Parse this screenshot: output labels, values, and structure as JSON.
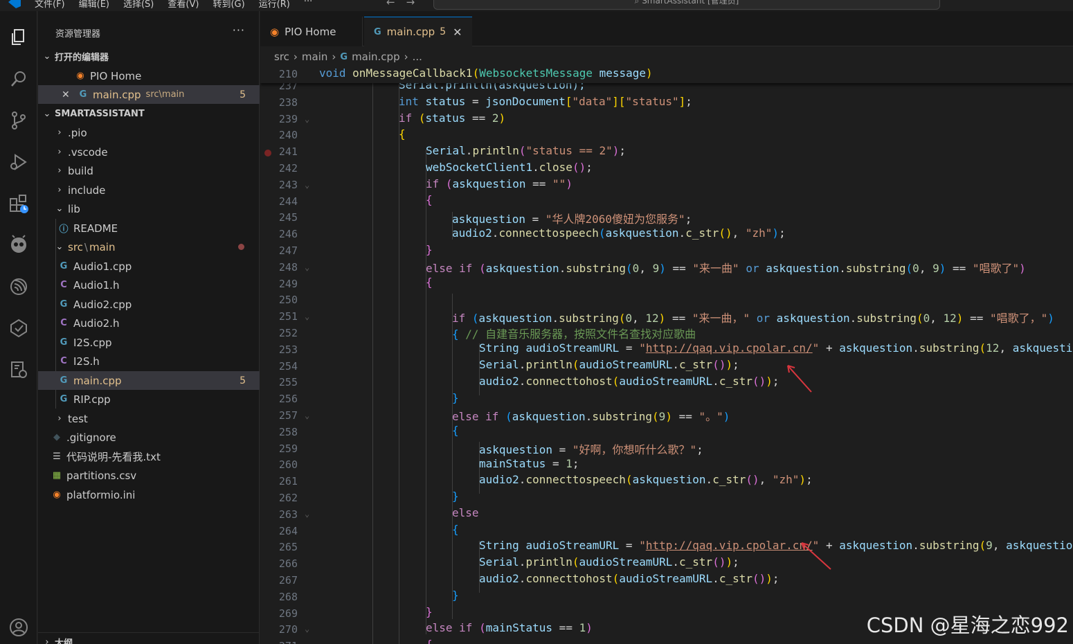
{
  "titlebar": {
    "menu": [
      "文件(F)",
      "编辑(E)",
      "选择(S)",
      "查看(V)",
      "转到(G)",
      "运行(R)",
      "···"
    ],
    "back": "←",
    "forward": "→",
    "search": "SmartAssistant [管理员]"
  },
  "activity_icons": [
    "explorer-icon",
    "search-icon",
    "source-control-icon",
    "run-debug-icon",
    "extensions-icon",
    "platformio-icon",
    "esp-idf-icon",
    "testing-icon",
    "remote-explorer-icon",
    "account-icon"
  ],
  "sidebar": {
    "title": "资源管理器",
    "more": "···",
    "open_editors": {
      "label": "打开的编辑器",
      "items": [
        {
          "name": "PIO Home",
          "path": ""
        },
        {
          "name": "main.cpp",
          "path": "src\\main",
          "count": "5"
        }
      ]
    },
    "workspace": {
      "label": "SMARTASSISTANT",
      "items": [
        {
          "label": ".pio",
          "kind": "folder",
          "chev": "›"
        },
        {
          "label": ".vscode",
          "kind": "folder",
          "chev": "›"
        },
        {
          "label": "build",
          "kind": "folder",
          "chev": "›"
        },
        {
          "label": "include",
          "kind": "folder",
          "chev": "›"
        },
        {
          "label": "lib",
          "kind": "folder",
          "chev": "⌄"
        },
        {
          "label": "README",
          "kind": "info"
        },
        {
          "label": "src",
          "sep": "\\",
          "label2": "main",
          "kind": "folder-open",
          "chev": "⌄"
        },
        {
          "label": "Audio1.cpp",
          "kind": "cpp"
        },
        {
          "label": "Audio1.h",
          "kind": "h"
        },
        {
          "label": "Audio2.cpp",
          "kind": "cpp"
        },
        {
          "label": "Audio2.h",
          "kind": "h"
        },
        {
          "label": "I2S.cpp",
          "kind": "cpp"
        },
        {
          "label": "I2S.h",
          "kind": "h"
        },
        {
          "label": "main.cpp",
          "kind": "cpp",
          "count": "5"
        },
        {
          "label": "RIP.cpp",
          "kind": "cpp"
        },
        {
          "label": "test",
          "kind": "folder",
          "chev": "›"
        },
        {
          "label": ".gitignore",
          "kind": "git"
        },
        {
          "label": "代码说明-先看我.txt",
          "kind": "txt"
        },
        {
          "label": "partitions.csv",
          "kind": "csv"
        },
        {
          "label": "platformio.ini",
          "kind": "pio"
        }
      ]
    },
    "outline_label": "大纲"
  },
  "tabs": [
    {
      "label": "PIO Home"
    },
    {
      "label": "main.cpp",
      "count": "5",
      "close": "✕"
    }
  ],
  "breadcrumb": [
    "src",
    "main",
    "main.cpp",
    "..."
  ],
  "sticky": {
    "line": "210",
    "code": "void onMessageCallback1(WebsocketsMessage message)"
  },
  "lines": [
    "237",
    "238",
    "239",
    "240",
    "241",
    "242",
    "243",
    "244",
    "245",
    "246",
    "247",
    "248",
    "249",
    "250",
    "251",
    "252",
    "253",
    "254",
    "255",
    "256",
    "257",
    "258",
    "259",
    "260",
    "261",
    "262",
    "263",
    "264",
    "265",
    "266",
    "267",
    "268",
    "269",
    "270",
    "271"
  ],
  "strings": {
    "l237": "Serial.println(askquestion);",
    "data": "\"data\"",
    "status_key": "\"status\"",
    "status2": "\"status == 2\"",
    "empty": "\"\"",
    "huaren": "\"华人牌2060傻妞为您服务\"",
    "zh": "\"zh\"",
    "laiyiqu": "\"来一曲\"",
    "changgele": "\"唱歌了\"",
    "laiyiqu2": "\"来一曲，\"",
    "changgele2": "\"唱歌了，\"",
    "comment": "// 自建音乐服务器，按照文件名查找对应歌曲",
    "url": "http://qaq.vip.cpolar.cn/",
    "period": "\"。\"",
    "haoa": "\"好啊，你想听什么歌？\"",
    "askq_trunc1": "askquesti",
    "askq_trunc2": "askquestio"
  },
  "watermark": "CSDN @星海之恋992"
}
